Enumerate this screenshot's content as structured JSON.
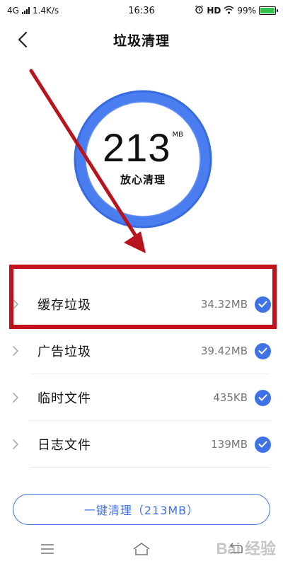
{
  "status_bar": {
    "network": "4G",
    "speed": "1.4K/s",
    "time": "16:36",
    "hd": "HD",
    "battery": "99%",
    "battery_level": 0.99,
    "battery_color": "#31c24d"
  },
  "header": {
    "title": "垃圾清理",
    "back_icon": "chevron-left-icon"
  },
  "summary": {
    "value": "213",
    "unit": "MB",
    "caption": "放心清理"
  },
  "items": [
    {
      "label": "缓存垃圾",
      "size": "34.32MB",
      "checked": true
    },
    {
      "label": "广告垃圾",
      "size": "39.42MB",
      "checked": true
    },
    {
      "label": "临时文件",
      "size": "435KB",
      "checked": true
    },
    {
      "label": "日志文件",
      "size": "139MB",
      "checked": true
    }
  ],
  "clean_button": {
    "label": "一键清理（213MB）"
  },
  "nav": {
    "menu_icon": "menu-icon",
    "home_icon": "home-icon",
    "back_icon": "back-icon"
  },
  "watermark": "Bai 经验",
  "colors": {
    "accent": "#3f72e6",
    "ring": "#4a7df0",
    "annotation": "#c0121c"
  }
}
